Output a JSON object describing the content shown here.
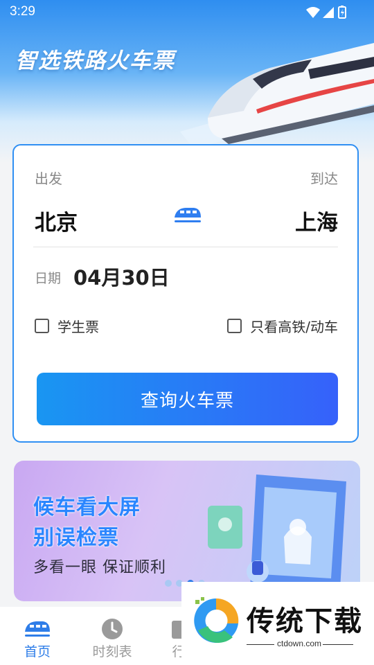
{
  "status": {
    "time": "3:29"
  },
  "hero": {
    "title": "智选铁路火车票"
  },
  "search": {
    "depart_label": "出发",
    "arrive_label": "到达",
    "from_city": "北京",
    "to_city": "上海",
    "date_label": "日期",
    "date_value": "04月30日",
    "student_label": "学生票",
    "highspeed_label": "只看高铁/动车",
    "button_label": "查询火车票"
  },
  "banner": {
    "line1": "候车看大屏",
    "line2": "别误检票",
    "subtitle": "多看一眼 保证顺利",
    "pages": 4,
    "active_page": 3
  },
  "tabs": [
    {
      "label": "首页",
      "icon": "train-icon",
      "active": true
    },
    {
      "label": "时刻表",
      "icon": "clock-icon",
      "active": false
    },
    {
      "label": "行",
      "icon": "trip-icon",
      "active": false
    }
  ],
  "watermark": {
    "brand": "传统下载",
    "url": "ctdown.com"
  },
  "colors": {
    "accent": "#2f8ff3",
    "button_start": "#1996f2",
    "button_end": "#3661fa",
    "tab_active": "#2e7de8",
    "tab_inactive": "#9a9a9a"
  }
}
